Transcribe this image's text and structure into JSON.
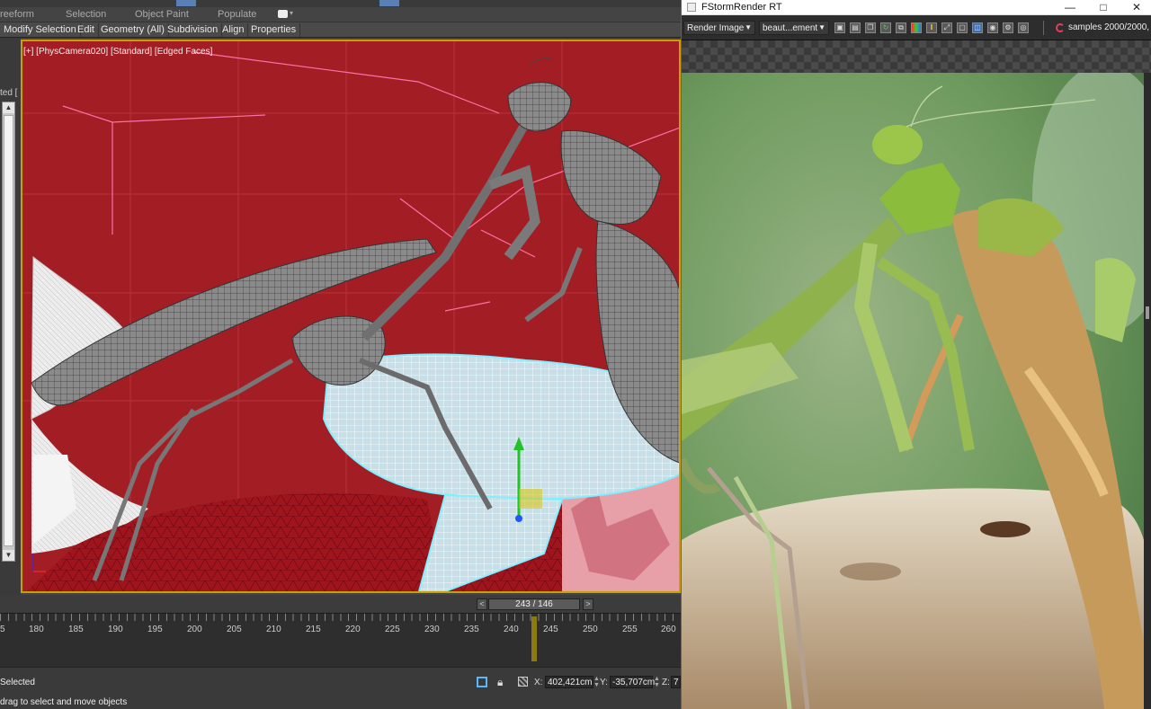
{
  "max": {
    "row2": [
      "reeform",
      "Selection",
      "Object Paint",
      "Populate"
    ],
    "menu": [
      "Modify Selection",
      "Edit",
      "Geometry (All)",
      "Subdivision",
      "Align",
      "Properties"
    ],
    "side_label": "ted [",
    "viewport_label": "[+] [PhysCamera020] [Standard] [Edged Faces]",
    "frame_counter": "243 / 146",
    "prev": "<",
    "next": ">",
    "ticks": [
      "5",
      "180",
      "185",
      "190",
      "195",
      "200",
      "205",
      "210",
      "215",
      "220",
      "225",
      "230",
      "235",
      "240",
      "245",
      "250",
      "255",
      "260"
    ],
    "status_selected": "Selected",
    "status_hint": "drag to select and move objects",
    "x_label": "X:",
    "x_value": "402,421cm",
    "y_label": "Y:",
    "y_value": "-35,707cm",
    "z_label": "Z:",
    "z_value": "7"
  },
  "fstorm": {
    "title": "FStormRender RT",
    "render_image": "Render Image",
    "element": "beaut...ement",
    "samples": "samples 2000/2000, t"
  },
  "colors": {
    "viewport_bg": "#a31e24",
    "accent_yellow": "#c8a000",
    "selection_cyan": "#7ff0ff"
  }
}
